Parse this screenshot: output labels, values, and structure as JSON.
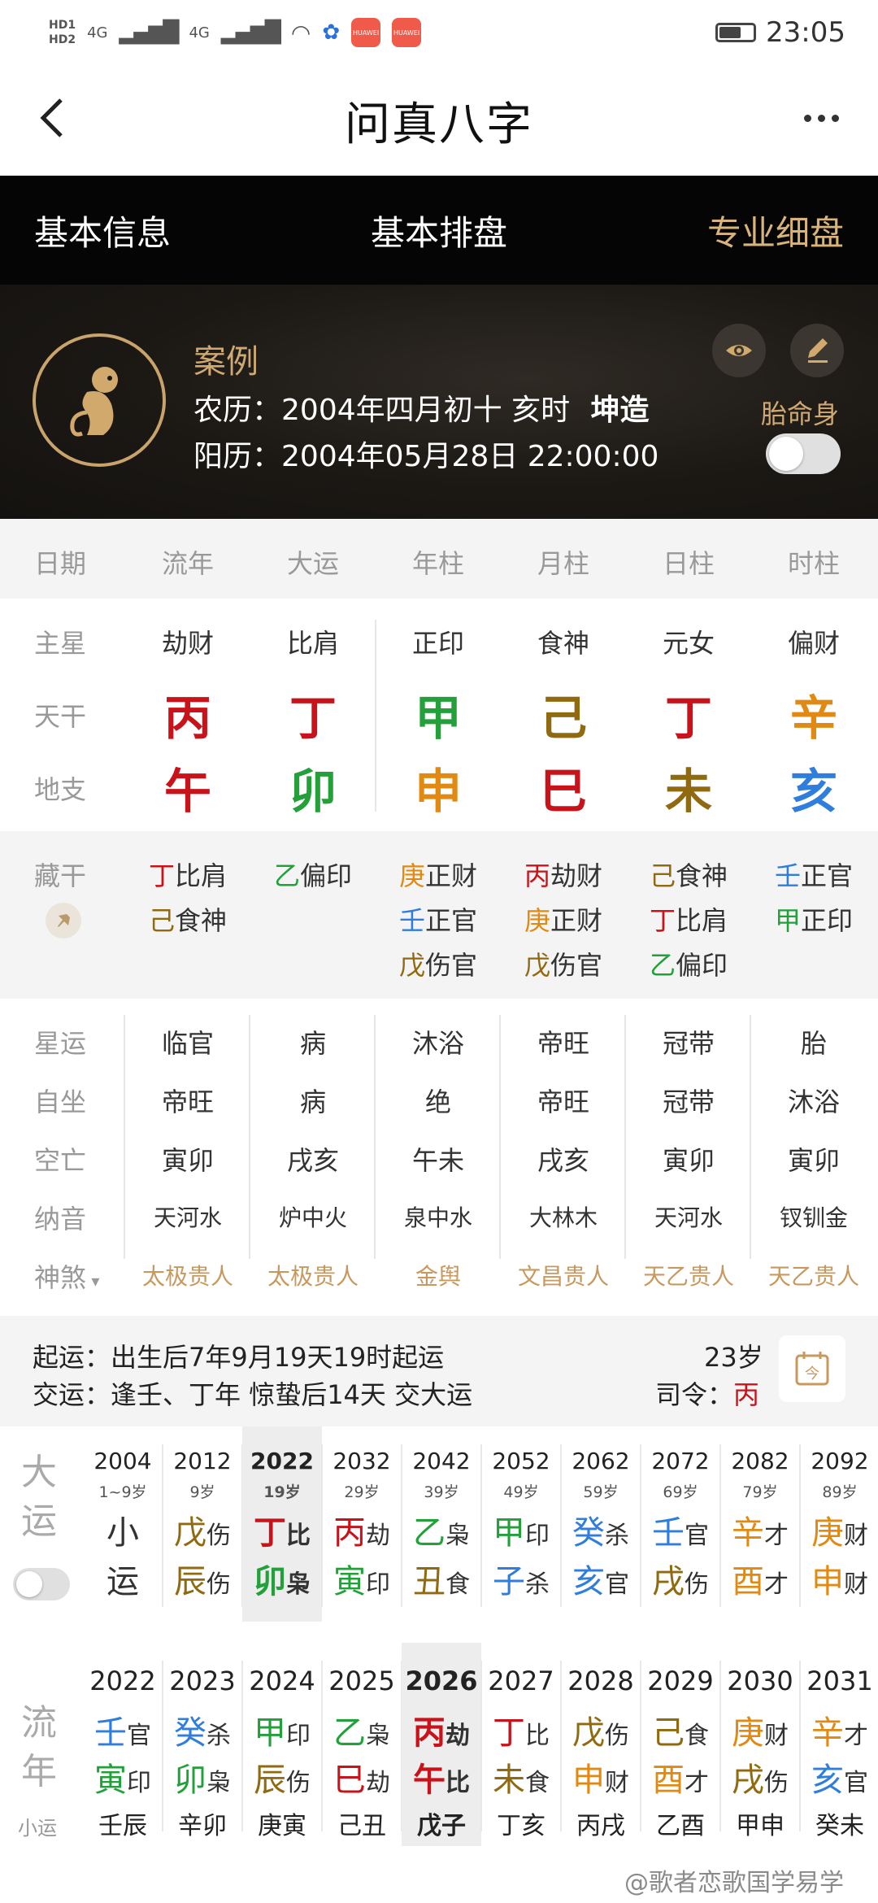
{
  "status": {
    "time": "23:05",
    "hd1": "HD1",
    "hd2": "HD2",
    "net1": "4G",
    "net2": "4G",
    "app_badge": "HUAWEI"
  },
  "header": {
    "title": "问真八字"
  },
  "tabs": [
    {
      "label": "基本信息"
    },
    {
      "label": "基本排盘"
    },
    {
      "label": "专业细盘"
    }
  ],
  "profile": {
    "case_label": "案例",
    "lunar_prefix": "农历：",
    "lunar": "2004年四月初十 亥时",
    "gender": "坤造",
    "solar_prefix": "阳历：",
    "solar": "2004年05月28日 22:00:00",
    "taimingshen_label": "胎命身"
  },
  "columns": [
    "日期",
    "流年",
    "大运",
    "年柱",
    "月柱",
    "日柱",
    "时柱"
  ],
  "rows": {
    "zhuxing": {
      "label": "主星",
      "values": [
        "劫财",
        "比肩",
        "正印",
        "食神",
        "元女",
        "偏财"
      ]
    },
    "tiangan": {
      "label": "天干",
      "values": [
        "丙",
        "丁",
        "甲",
        "己",
        "丁",
        "辛"
      ],
      "colors": [
        "#c8131a",
        "#c8131a",
        "#23a03a",
        "#8f6a10",
        "#c8131a",
        "#e08a14"
      ]
    },
    "dizhi": {
      "label": "地支",
      "values": [
        "午",
        "卯",
        "申",
        "巳",
        "未",
        "亥"
      ],
      "colors": [
        "#c8131a",
        "#23a03a",
        "#e08a14",
        "#c8131a",
        "#8f6a10",
        "#2f7ddc"
      ]
    }
  },
  "canggan": {
    "label": "藏干",
    "cols": [
      [
        {
          "g": "丁",
          "s": "比肩",
          "c": "#c8131a"
        },
        {
          "g": "己",
          "s": "食神",
          "c": "#8f6a10"
        }
      ],
      [
        {
          "g": "乙",
          "s": "偏印",
          "c": "#23a03a"
        }
      ],
      [
        {
          "g": "庚",
          "s": "正财",
          "c": "#e08a14"
        },
        {
          "g": "壬",
          "s": "正官",
          "c": "#2f7ddc"
        },
        {
          "g": "戊",
          "s": "伤官",
          "c": "#8f6a10"
        }
      ],
      [
        {
          "g": "丙",
          "s": "劫财",
          "c": "#c8131a"
        },
        {
          "g": "庚",
          "s": "正财",
          "c": "#e08a14"
        },
        {
          "g": "戊",
          "s": "伤官",
          "c": "#8f6a10"
        }
      ],
      [
        {
          "g": "己",
          "s": "食神",
          "c": "#8f6a10"
        },
        {
          "g": "丁",
          "s": "比肩",
          "c": "#c8131a"
        },
        {
          "g": "乙",
          "s": "偏印",
          "c": "#23a03a"
        }
      ],
      [
        {
          "g": "壬",
          "s": "正官",
          "c": "#2f7ddc"
        },
        {
          "g": "甲",
          "s": "正印",
          "c": "#23a03a"
        }
      ]
    ]
  },
  "details": {
    "xingyun": {
      "label": "星运",
      "values": [
        "临官",
        "病",
        "沐浴",
        "帝旺",
        "冠带",
        "胎"
      ]
    },
    "zizuo": {
      "label": "自坐",
      "values": [
        "帝旺",
        "病",
        "绝",
        "帝旺",
        "冠带",
        "沐浴"
      ]
    },
    "kongwang": {
      "label": "空亡",
      "values": [
        "寅卯",
        "戌亥",
        "午未",
        "戌亥",
        "寅卯",
        "寅卯"
      ]
    },
    "nayin": {
      "label": "纳音",
      "values": [
        "天河水",
        "炉中火",
        "泉中水",
        "大林木",
        "天河水",
        "钗钏金"
      ]
    },
    "shensha": {
      "label": "神煞",
      "values": [
        "太极贵人",
        "太极贵人",
        "金舆",
        "文昌贵人",
        "天乙贵人",
        "天乙贵人"
      ]
    }
  },
  "qiyun": {
    "line1_label": "起运：",
    "line1": "出生后7年9月19天19时起运",
    "line2_label": "交运：",
    "line2": "逢壬、丁年 惊蛰后14天 交大运",
    "age": "23岁",
    "siling_label": "司令：",
    "siling": "丙"
  },
  "dayun": {
    "label_top": "大",
    "label_bottom": "运",
    "items": [
      {
        "year": "2004",
        "age": "1~9岁",
        "gan": "小",
        "gan_s": "",
        "zhi": "运",
        "zhi_s": "",
        "gc": "#333333",
        "zc": "#333333"
      },
      {
        "year": "2012",
        "age": "9岁",
        "gan": "戊",
        "gan_s": "伤",
        "zhi": "辰",
        "zhi_s": "伤",
        "gc": "#8f6a10",
        "zc": "#8f6a10"
      },
      {
        "year": "2022",
        "age": "19岁",
        "gan": "丁",
        "gan_s": "比",
        "zhi": "卯",
        "zhi_s": "枭",
        "gc": "#c8131a",
        "zc": "#23a03a"
      },
      {
        "year": "2032",
        "age": "29岁",
        "gan": "丙",
        "gan_s": "劫",
        "zhi": "寅",
        "zhi_s": "印",
        "gc": "#c8131a",
        "zc": "#23a03a"
      },
      {
        "year": "2042",
        "age": "39岁",
        "gan": "乙",
        "gan_s": "枭",
        "zhi": "丑",
        "zhi_s": "食",
        "gc": "#23a03a",
        "zc": "#8f6a10"
      },
      {
        "year": "2052",
        "age": "49岁",
        "gan": "甲",
        "gan_s": "印",
        "zhi": "子",
        "zhi_s": "杀",
        "gc": "#23a03a",
        "zc": "#2f7ddc"
      },
      {
        "year": "2062",
        "age": "59岁",
        "gan": "癸",
        "gan_s": "杀",
        "zhi": "亥",
        "zhi_s": "官",
        "gc": "#2f7ddc",
        "zc": "#2f7ddc"
      },
      {
        "year": "2072",
        "age": "69岁",
        "gan": "壬",
        "gan_s": "官",
        "zhi": "戌",
        "zhi_s": "伤",
        "gc": "#2f7ddc",
        "zc": "#8f6a10"
      },
      {
        "year": "2082",
        "age": "79岁",
        "gan": "辛",
        "gan_s": "才",
        "zhi": "酉",
        "zhi_s": "才",
        "gc": "#e08a14",
        "zc": "#e08a14"
      },
      {
        "year": "2092",
        "age": "89岁",
        "gan": "庚",
        "gan_s": "财",
        "zhi": "申",
        "zhi_s": "财",
        "gc": "#e08a14",
        "zc": "#e08a14"
      }
    ]
  },
  "liunian": {
    "label_top": "流",
    "label_bottom": "年",
    "label_small": "小运",
    "items": [
      {
        "year": "2022",
        "gan": "壬",
        "gan_s": "官",
        "zhi": "寅",
        "zhi_s": "印",
        "xy": "壬辰",
        "gc": "#2f7ddc",
        "zc": "#23a03a"
      },
      {
        "year": "2023",
        "gan": "癸",
        "gan_s": "杀",
        "zhi": "卯",
        "zhi_s": "枭",
        "xy": "辛卯",
        "gc": "#2f7ddc",
        "zc": "#23a03a"
      },
      {
        "year": "2024",
        "gan": "甲",
        "gan_s": "印",
        "zhi": "辰",
        "zhi_s": "伤",
        "xy": "庚寅",
        "gc": "#23a03a",
        "zc": "#8f6a10"
      },
      {
        "year": "2025",
        "gan": "乙",
        "gan_s": "枭",
        "zhi": "巳",
        "zhi_s": "劫",
        "xy": "己丑",
        "gc": "#23a03a",
        "zc": "#c8131a"
      },
      {
        "year": "2026",
        "gan": "丙",
        "gan_s": "劫",
        "zhi": "午",
        "zhi_s": "比",
        "xy": "戊子",
        "gc": "#c8131a",
        "zc": "#c8131a"
      },
      {
        "year": "2027",
        "gan": "丁",
        "gan_s": "比",
        "zhi": "未",
        "zhi_s": "食",
        "xy": "丁亥",
        "gc": "#c8131a",
        "zc": "#8f6a10"
      },
      {
        "year": "2028",
        "gan": "戊",
        "gan_s": "伤",
        "zhi": "申",
        "zhi_s": "财",
        "xy": "丙戌",
        "gc": "#8f6a10",
        "zc": "#e08a14"
      },
      {
        "year": "2029",
        "gan": "己",
        "gan_s": "食",
        "zhi": "酉",
        "zhi_s": "才",
        "xy": "乙酉",
        "gc": "#8f6a10",
        "zc": "#e08a14"
      },
      {
        "year": "2030",
        "gan": "庚",
        "gan_s": "财",
        "zhi": "戌",
        "zhi_s": "伤",
        "xy": "甲申",
        "gc": "#e08a14",
        "zc": "#8f6a10"
      },
      {
        "year": "2031",
        "gan": "辛",
        "gan_s": "才",
        "zhi": "亥",
        "zhi_s": "官",
        "xy": "癸未",
        "gc": "#e08a14",
        "zc": "#2f7ddc"
      }
    ]
  },
  "watermark": "@歌者恋歌国学易学"
}
